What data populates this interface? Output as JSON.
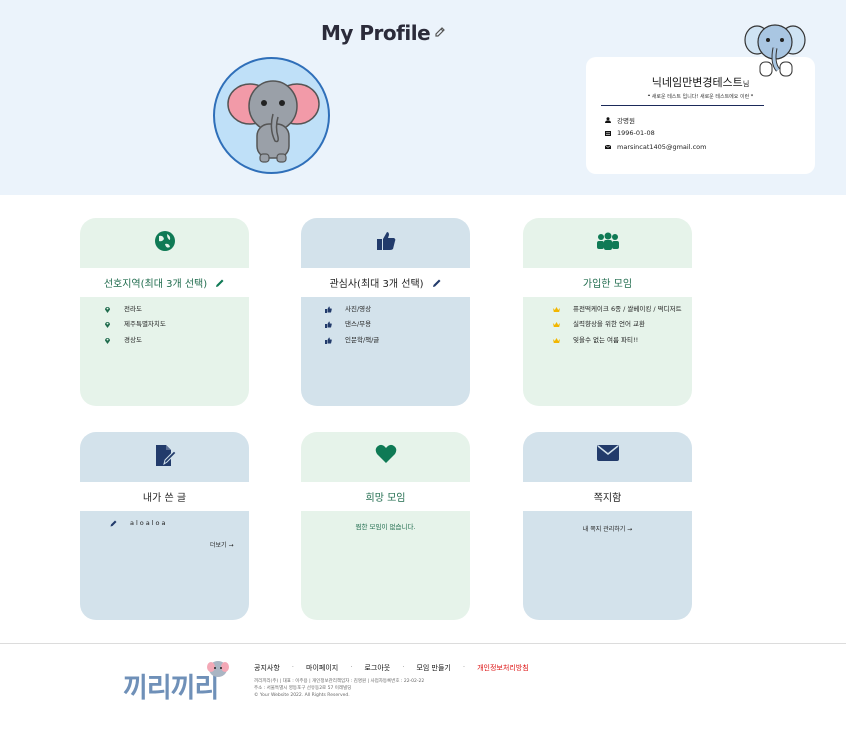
{
  "header": {
    "title": "My Profile",
    "edit_icon": "edit-icon"
  },
  "profile": {
    "nickname": "닉네임만변경테스트",
    "nickname_suffix": "님",
    "status_message": "❝ 새로운 테스트 입니다! 새로운 테스트에요 이런 ❞",
    "name": "강명원",
    "birthdate": "1996-01-08",
    "email": "marsincat1405@gmail.com"
  },
  "tiles": {
    "regions": {
      "title": "선호지역(최대 3개 선택)",
      "items": [
        "전라도",
        "제주특별자치도",
        "경상도"
      ]
    },
    "interests": {
      "title": "관심사(최대 3개 선택)",
      "items": [
        "사진/영상",
        "댄스/무용",
        "인문학/책/글"
      ]
    },
    "joined": {
      "title": "가입한 모임",
      "items": [
        "퓨전떡케이크 6종 / 쌀베이킹 / 떡디저트",
        "실력향상을 위한 언어 교환",
        "잊을수 없는 여름 파티!!"
      ]
    },
    "posts": {
      "title": "내가 쓴 글",
      "items": [
        "aloaloa"
      ],
      "more": "더보기 →"
    },
    "wishlist": {
      "title": "희망 모임",
      "empty": "찜한 모임이 없습니다."
    },
    "messages": {
      "title": "쪽지함",
      "link": "내 쪽지 관리하기 →"
    }
  },
  "footer": {
    "logo_text": "끼리끼리",
    "nav": [
      "공지사항",
      "마이페이지",
      "로그아웃",
      "모임 만들기",
      "개인정보처리방침"
    ],
    "company": "끼리끼리(주) | 대표 : 이주용 | 개인정보관리책임자 : 김명원 | 사업자등록번호 : 22-02-22",
    "address": "주소 : 서울특별시 영등포구 선유동2로 57 이레빌딩",
    "copyright": "© Your Website 2022. All Rights Reserved."
  },
  "colors": {
    "hero_bg": "#ebf3fb",
    "tile_green": "#e6f3ea",
    "tile_blue": "#d3e2eb",
    "accent_teal": "#0f7a55",
    "accent_navy": "#223b6b",
    "crown": "#f2b600"
  }
}
